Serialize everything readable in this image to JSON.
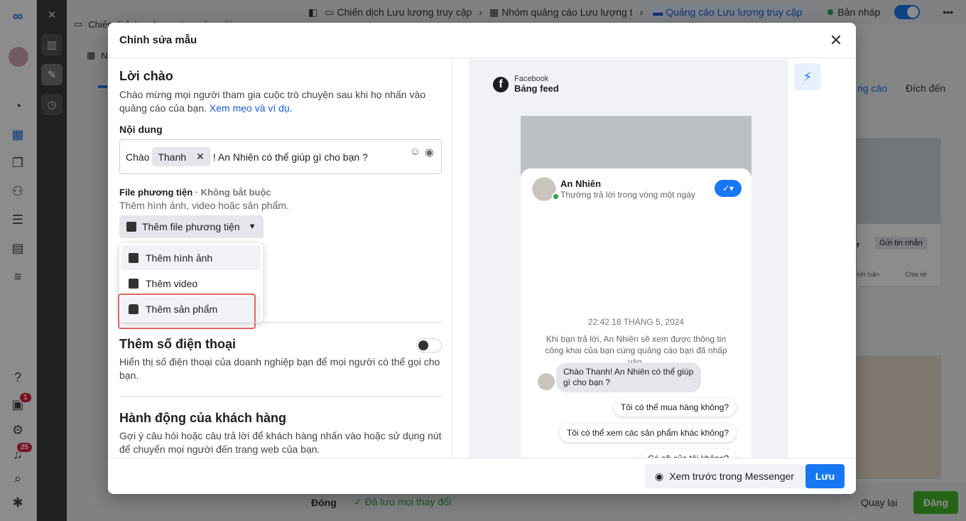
{
  "topbar": {
    "crumb_campaign": "Chiến dịch Lưu lượng truy cập",
    "crumb_adset": "Nhóm quảng cáo Lưu lượng t",
    "crumb_ad": "Quảng cáo Lưu lượng truy cập",
    "status": "Bản nháp",
    "more": "•••"
  },
  "tree": {
    "item_campaign": "Chiến dịch Lưu lượng truy cập mới",
    "item_adset": "N"
  },
  "rail": {
    "badge_notifications": "1",
    "badge_alerts": "25"
  },
  "right_panel": {
    "tab_ad": "ng cáo",
    "tab_destination": "Đích đến",
    "send_message": "Gửi tin nhắn",
    "comment": "ình luận",
    "share": "Chia sẻ",
    "letter_r": "r"
  },
  "bottombar": {
    "close": "Đóng",
    "saved": "Đã lưu mọi thay đổi",
    "back": "Quay lại",
    "publish": "Đăng"
  },
  "modal": {
    "title": "Chỉnh sửa mẫu",
    "greeting": {
      "heading": "Lời chào",
      "desc": "Chào mừng mọi người tham gia cuộc trò chuyện sau khi họ nhấn vào quảng cáo của bạn.",
      "link": "Xem mẹo và ví dụ.",
      "content_label": "Nội dung",
      "content_prefix": "Chào",
      "chip_name": "Thanh",
      "content_suffix": "! An Nhiên có thể giúp gì cho bạn ?"
    },
    "media": {
      "label": "File phương tiện",
      "optional": "· Không bắt buộc",
      "hint": "Thêm hình ảnh, video hoặc sản phẩm.",
      "button": "Thêm file phương tiện",
      "options": [
        "Thêm hình ảnh",
        "Thêm video",
        "Thêm sản phẩm"
      ]
    },
    "phone": {
      "heading": "Thêm số điện thoại",
      "desc": "Hiển thị số điện thoại của doanh nghiệp bạn để mọi người có thể gọi cho bạn."
    },
    "actions": {
      "heading": "Hành động của khách hàng",
      "desc": "Gợi ý câu hỏi hoặc câu trả lời để khách hàng nhấn vào hoặc sử dụng nút để chuyển mọi người đến trang web của bạn."
    },
    "preview": {
      "platform": "Facebook",
      "placement": "Bảng feed",
      "page_name": "An Nhiên",
      "response_time": "Thường trả lời trong vòng một ngày",
      "timestamp": "22:42 18 THÁNG 5, 2024",
      "info": "Khi bạn trả lời, An Nhiên sẽ xem được thông tin công khai của bạn cùng quảng cáo bạn đã nhấp vào.",
      "greeting_bubble": "Chào Thanh! An Nhiên có thể giúp gì cho bạn ?",
      "q1": "Tôi có thể mua hàng không?",
      "q2": "Tôi có thể xem các sản phẩm khác không?",
      "q3": "Có cỡ của tôi không?"
    },
    "footer": {
      "preview_btn": "Xem trước trong Messenger",
      "save_btn": "Lưu"
    }
  }
}
